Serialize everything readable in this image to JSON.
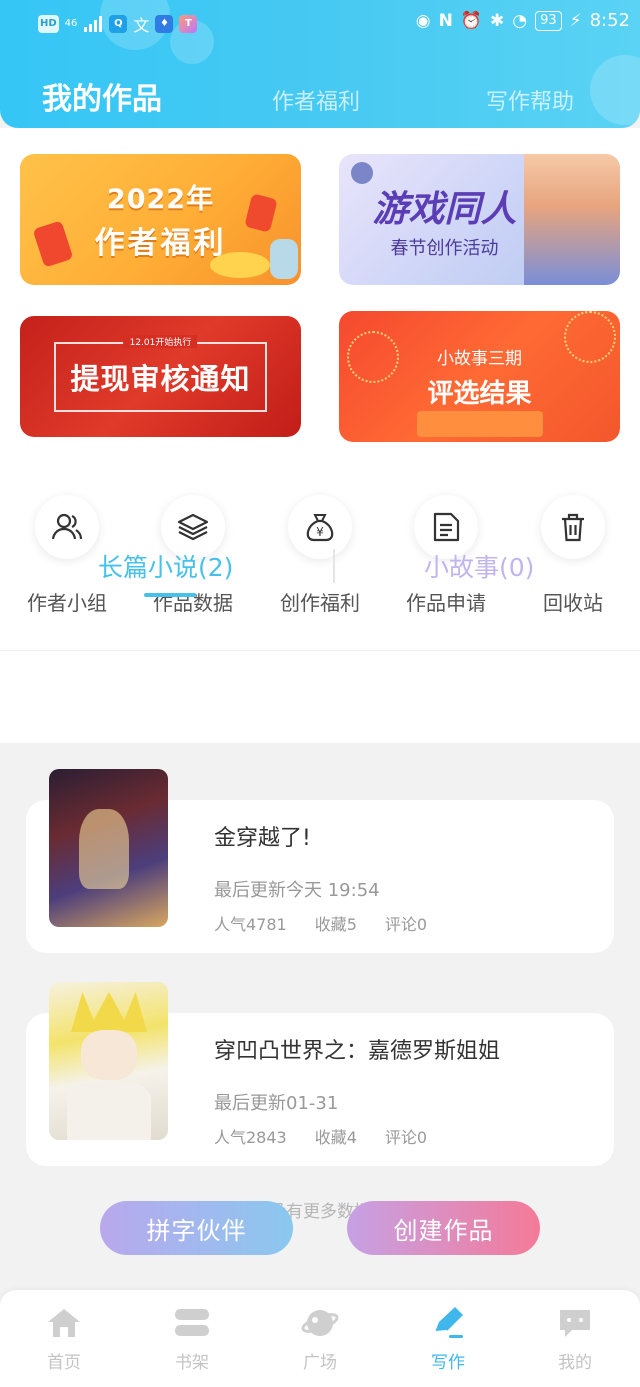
{
  "status_bar": {
    "left_icons": [
      "HD",
      "4G",
      "signal-icon",
      "search-app-icon",
      "translate-app-icon",
      "bulb-app-icon",
      "app-icon"
    ],
    "network": "46",
    "battery": "93",
    "time": "8:52"
  },
  "header": {
    "tabs": [
      {
        "label": "我的作品",
        "active": true
      },
      {
        "label": "作者福利",
        "active": false
      },
      {
        "label": "写作帮助",
        "active": false
      }
    ]
  },
  "banners": [
    {
      "line1": "2022年",
      "line2": "作者福利"
    },
    {
      "line1": "游戏同人",
      "line2": "春节创作活动"
    },
    {
      "small": "12.01开始执行",
      "line2": "提现审核通知"
    },
    {
      "line1": "小故事三期",
      "line2": "评选结果"
    }
  ],
  "quick_actions": [
    {
      "label": "作者小组",
      "icon": "group-icon"
    },
    {
      "label": "作品数据",
      "icon": "layers-icon"
    },
    {
      "label": "创作福利",
      "icon": "money-bag-icon"
    },
    {
      "label": "作品申请",
      "icon": "document-icon"
    },
    {
      "label": "回收站",
      "icon": "trash-icon"
    }
  ],
  "segments": {
    "long": "长篇小说(2)",
    "short": "小故事(0)"
  },
  "works": [
    {
      "title": "金穿越了!",
      "updated": "最后更新今天 19:54",
      "popularity": "人气4781",
      "favorites": "收藏5",
      "comments": "评论0"
    },
    {
      "title": "穿凹凸世界之：嘉德罗斯姐姐",
      "updated": "最后更新01-31",
      "popularity": "人气2843",
      "favorites": "收藏4",
      "comments": "评论0"
    }
  ],
  "footer_note": "没有更多数据",
  "actions": {
    "partner": "拼字伙伴",
    "create": "创建作品"
  },
  "bottom_nav": [
    {
      "label": "首页",
      "icon": "home-icon"
    },
    {
      "label": "书架",
      "icon": "bookshelf-icon"
    },
    {
      "label": "广场",
      "icon": "planet-icon"
    },
    {
      "label": "写作",
      "icon": "pen-icon",
      "active": true
    },
    {
      "label": "我的",
      "icon": "chat-icon"
    }
  ],
  "colors": {
    "accent": "#46c1ea",
    "secondary": "#c2b4ee",
    "header": "#3cc7f5"
  }
}
